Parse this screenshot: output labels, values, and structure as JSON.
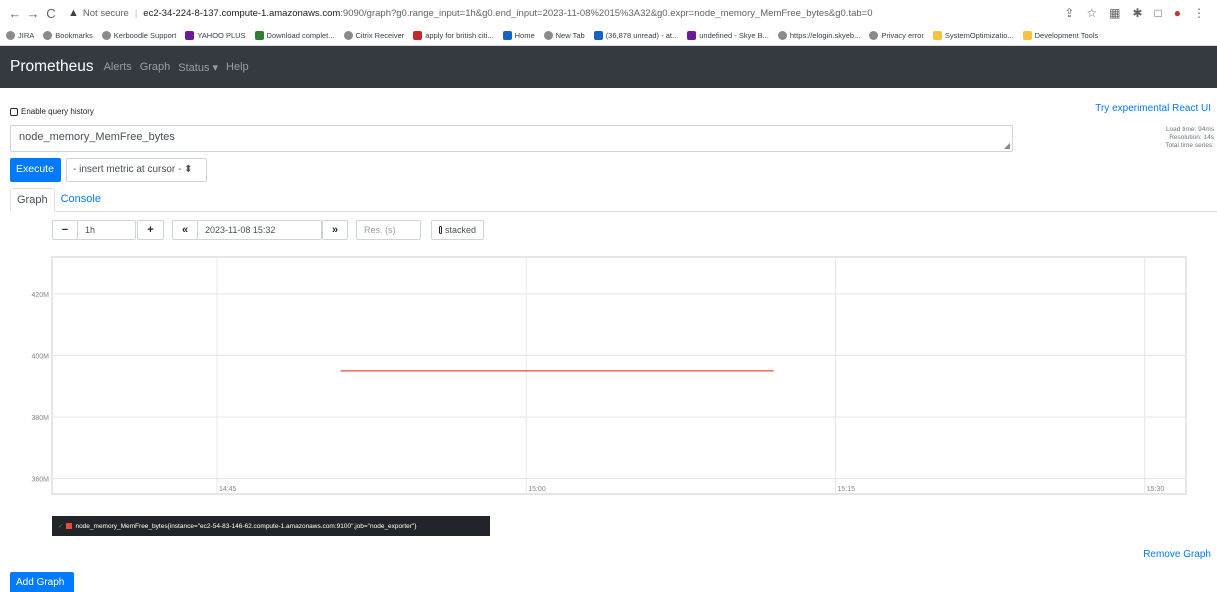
{
  "browser": {
    "not_secure": "Not secure",
    "host": "ec2-34-224-8-137.compute-1.amazonaws.com",
    "path": ":9090/graph?g0.range_input=1h&g0.end_input=2023-11-08%2015%3A32&g0.expr=node_memory_MemFree_bytes&g0.tab=0",
    "bookmarks": [
      {
        "label": "JIRA",
        "icon": "jira-icon"
      },
      {
        "label": "Bookmarks",
        "icon": "star-icon"
      },
      {
        "label": "Kerboodle Support",
        "icon": "globe-icon"
      },
      {
        "label": "YAHOO PLUS",
        "icon": "yahoo-icon"
      },
      {
        "label": "Download complet...",
        "icon": "download-icon"
      },
      {
        "label": "Citrix Receiver",
        "icon": "citrix-icon"
      },
      {
        "label": "apply for british citi...",
        "icon": "google-icon"
      },
      {
        "label": "Home",
        "icon": "linkedin-icon"
      },
      {
        "label": "New Tab",
        "icon": "globe-icon"
      },
      {
        "label": "(36,878 unread) - at...",
        "icon": "mail-icon"
      },
      {
        "label": "undefined - Skye B...",
        "icon": "page-icon"
      },
      {
        "label": "https://elogin.skyeb...",
        "icon": "globe-icon"
      },
      {
        "label": "Privacy error",
        "icon": "globe-icon"
      },
      {
        "label": "SystemOptimizatio...",
        "icon": "folder-icon"
      },
      {
        "label": "Development Tools",
        "icon": "folder-icon"
      }
    ]
  },
  "navbar": {
    "brand": "Prometheus",
    "links": [
      "Alerts",
      "Graph",
      "Status ▾",
      "Help"
    ]
  },
  "query": {
    "history_label": "Enable query history",
    "react_link": "Try experimental React UI",
    "expression": "node_memory_MemFree_bytes",
    "load_time": "Load time: 94ms",
    "resolution": "Resolution: 14s",
    "total_series": "Total time series:",
    "execute_label": "Execute",
    "metric_select": "- insert metric at cursor -"
  },
  "tabs": [
    {
      "label": "Graph",
      "active": true
    },
    {
      "label": "Console",
      "active": false
    }
  ],
  "controls": {
    "range": "1h",
    "end_time": "2023-11-08 15:32",
    "res_placeholder": "Res. (s)",
    "stacked_label": "stacked"
  },
  "chart_data": {
    "type": "line",
    "x_ticks": [
      "14:45",
      "15:00",
      "15:15",
      "15:30"
    ],
    "y_ticks": [
      "360M",
      "380M",
      "400M",
      "420M"
    ],
    "ylim": [
      355,
      432
    ],
    "y_units": "M",
    "series": [
      {
        "name": "node_memory_MemFree_bytes{instance=\"ec2-54-83-146-62.compute-1.amazonaws.com:9100\",job=\"node_exporter\"}",
        "color": "#e74c3c",
        "x": [
          "14:51",
          "15:12"
        ],
        "values": [
          395,
          395
        ]
      }
    ],
    "grid": true
  },
  "legend_text": "node_memory_MemFree_bytes{instance=\"ec2-54-83-146-62.compute-1.amazonaws.com:9100\",job=\"node_exporter\"}",
  "remove_graph": "Remove Graph",
  "add_graph": "Add Graph"
}
